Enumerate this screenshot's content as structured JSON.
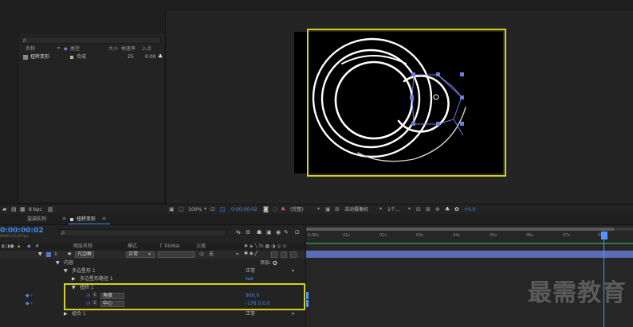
{
  "project": {
    "search_placeholder": "ρ.",
    "columns": {
      "name": "名称",
      "type": "类型",
      "size": "大小",
      "fps": "帧速率",
      "in": "入点"
    },
    "items": [
      {
        "name": "扭转变形",
        "type": "合成",
        "fps": "25",
        "in": "0:00"
      }
    ],
    "footer_bpc": "8 bpc"
  },
  "viewer": {
    "zoom": "100%",
    "timecode": "0:00:00:02",
    "quality": "(完整)",
    "camera": "活动摄像机",
    "views": "1个...",
    "exposure": "+0.0"
  },
  "timeline": {
    "tabs": [
      {
        "label": "渲染队列"
      },
      {
        "label": "扭转变形"
      }
    ],
    "current_time": "0:00:00:02",
    "current_time_sub": "00002 (25.00 fps)",
    "search_placeholder": "ρ.",
    "headers": {
      "layer_name": "图层名称",
      "mode": "模式",
      "trkmat": "T TrkMat",
      "parent": "父级"
    },
    "layer": {
      "number": "1",
      "name": "凡边框",
      "mode": "正常",
      "parent": "无"
    },
    "rows": {
      "contents": "内容",
      "add": "添加:",
      "polystar": "多边星形 1",
      "polystar_mode": "正常",
      "polystar_path": "多边星形路径 1",
      "twist": "扭转 1",
      "angle_label": "角度",
      "angle_value": "960.0",
      "center_label": "中心",
      "center_value": "-176.0,0.0",
      "group": "组合 1",
      "group_mode": "正常"
    },
    "ruler": [
      "0:00s",
      "01s",
      "02s",
      "03s",
      "04s",
      "05s",
      "06s",
      "07s",
      "08s"
    ]
  },
  "watermark": "最需教育",
  "colors": {
    "accent_yellow": "#d8cf1a",
    "accent_blue": "#4a8ce8",
    "timecode_blue": "#3f8cf0",
    "playhead": "#4f96ff"
  }
}
